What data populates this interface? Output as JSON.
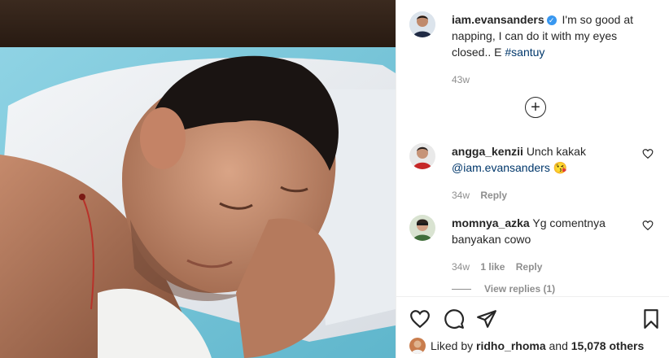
{
  "post": {
    "author": "iam.evansanders",
    "caption_text": "I'm so good at napping, I can do it with my eyes closed.. E",
    "hashtag": "#santuy",
    "time": "43w"
  },
  "load_more_symbol": "+",
  "comments": [
    {
      "author": "angga_kenzii",
      "text": "Unch kakak",
      "mention": "@iam.evansanders",
      "emoji": "😘",
      "time": "34w",
      "reply_label": "Reply"
    },
    {
      "author": "momnya_azka",
      "text": "Yg comentnya banyakan cowo",
      "time": "34w",
      "likes": "1 like",
      "reply_label": "Reply"
    }
  ],
  "view_replies": "View replies (1)",
  "likes_bar": {
    "prefix": "Liked by",
    "user": "ridho_rhoma",
    "joiner": "and",
    "count": "15,078 others"
  },
  "icons": {
    "verified": "verified-badge-icon",
    "like": "heart-icon",
    "comment": "comment-bubble-icon",
    "share": "paper-plane-icon",
    "save": "bookmark-icon",
    "load_more": "plus-circle-icon"
  },
  "colors": {
    "link": "#00376b",
    "verified": "#3897f0",
    "muted": "#8e8e8e",
    "text": "#262626"
  }
}
